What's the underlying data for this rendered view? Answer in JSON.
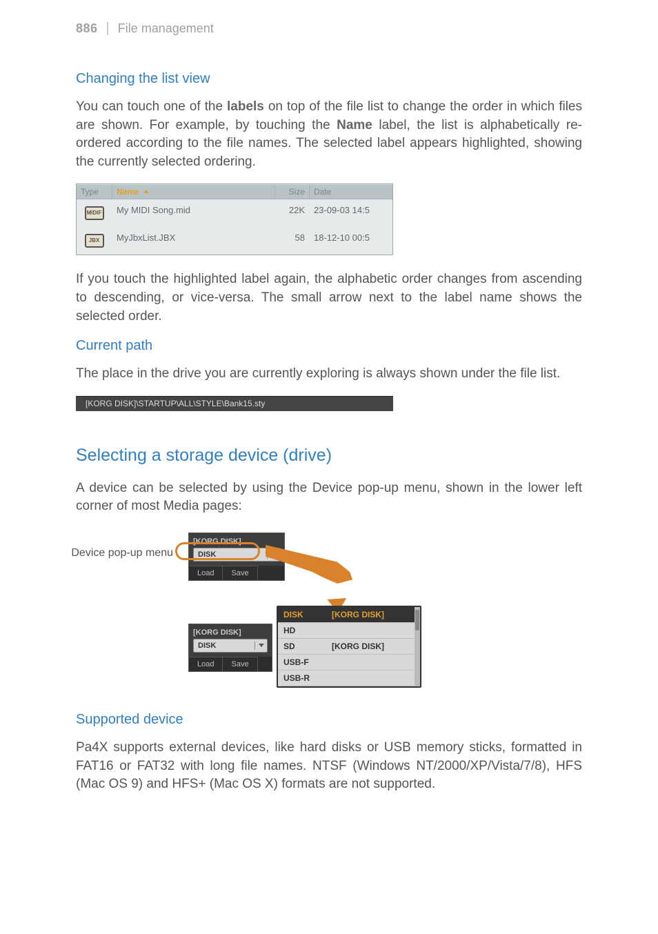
{
  "header": {
    "page_number": "886",
    "divider": "|",
    "section": "File management"
  },
  "h_changing": "Changing the list view",
  "p1a": "You can touch one of the ",
  "p1_labels": "labels",
  "p1b": " on top of the file list to change the order in which files are shown. For example, by touching the ",
  "p1_name": "Name",
  "p1c": " label, the list is alphabetically re-ordered according to the file names. The selected label appears highlighted, showing the currently selected ordering.",
  "filelist": {
    "cols": {
      "type": "Type",
      "name": "Name",
      "size": "Size",
      "date": "Date"
    },
    "rows": [
      {
        "icon": "MIDIF",
        "name": "My MIDI Song.mid",
        "size": "22K",
        "date": "23-09-03 14:5"
      },
      {
        "icon": "JBX",
        "name": "MyJbxList.JBX",
        "size": "58",
        "date": "18-12-10 00:5"
      }
    ]
  },
  "p2": "If you touch the highlighted label again, the alphabetic order changes from ascending to descending, or vice-versa. The small arrow next to the label name shows the selected order.",
  "h_current": "Current path",
  "p3": "The place in the drive you are currently exploring is always shown under the file list.",
  "pathbar": "[KORG DISK]\\STARTUP\\ALL\\STYLE\\Bank15.sty",
  "h_selecting": "Selecting a storage device (drive)",
  "p4": "A device can be selected by using the Device pop-up menu, shown in the lower left corner of most Media pages:",
  "device_fig": {
    "caption": "Device pop-up menu",
    "box1": {
      "label": "[KORG DISK]",
      "selected": "DISK",
      "tabs": [
        "Load",
        "Save"
      ]
    },
    "box2": {
      "label": "[KORG DISK]",
      "selected": "DISK",
      "tabs": [
        "Load",
        "Save"
      ]
    },
    "dropdown": [
      {
        "left": "DISK",
        "right": "[KORG DISK]",
        "selected": true
      },
      {
        "left": "HD",
        "right": "",
        "selected": false
      },
      {
        "left": "SD",
        "right": "[KORG DISK]",
        "selected": false
      },
      {
        "left": "USB-F",
        "right": "",
        "selected": false
      },
      {
        "left": "USB-R",
        "right": "",
        "selected": false
      }
    ]
  },
  "h_supported": "Supported device",
  "p5": "Pa4X supports external devices, like hard disks or USB memory sticks, formatted in FAT16 or FAT32 with long file names. NTSF (Windows NT/2000/XP/Vista/7/8), HFS (Mac OS 9) and HFS+ (Mac OS X) formats are not supported."
}
